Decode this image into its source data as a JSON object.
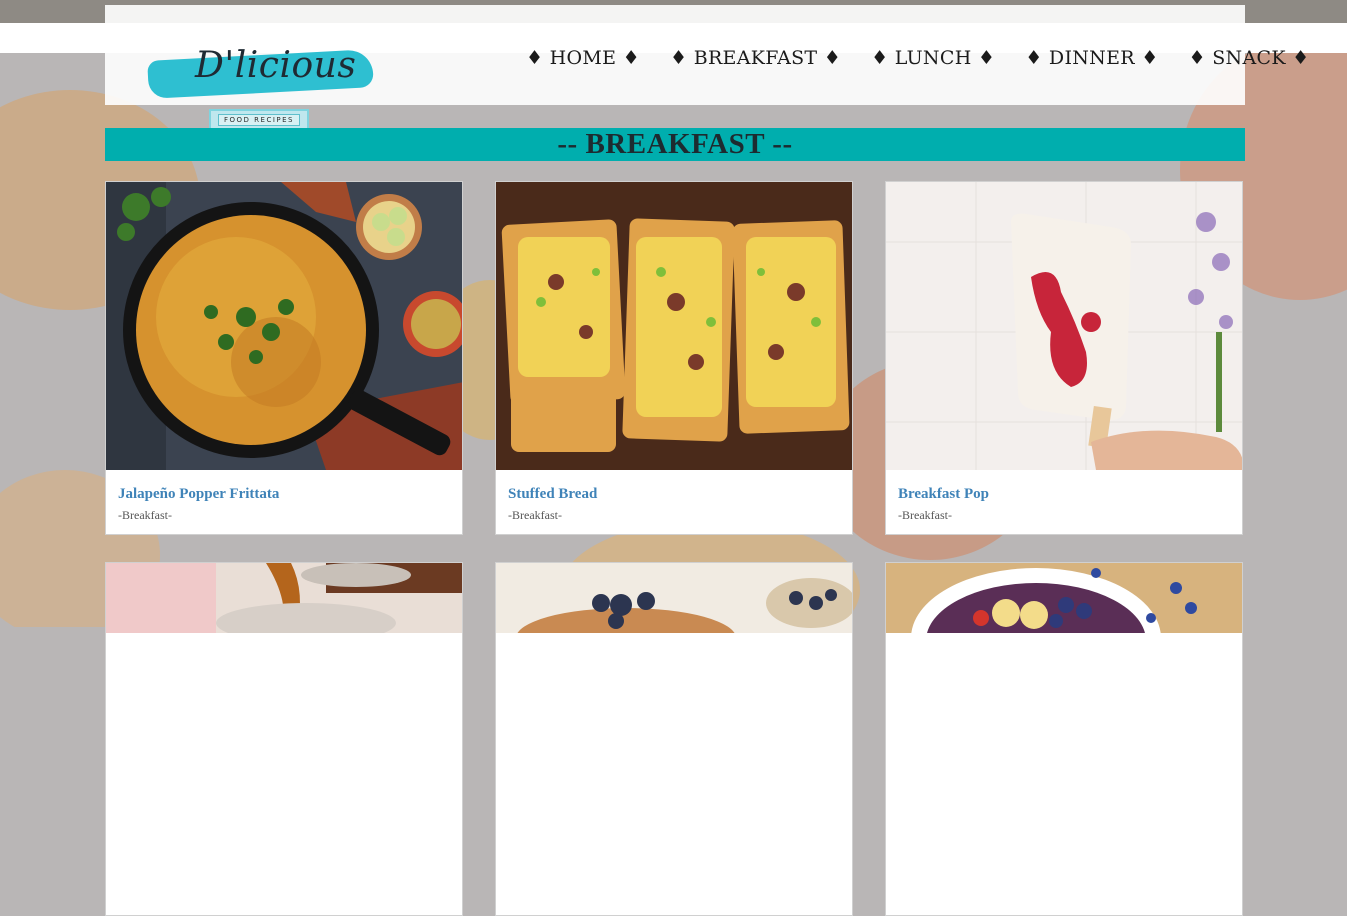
{
  "brand": {
    "logo_text": "D'licious",
    "tagline": "FOOD RECIPES"
  },
  "nav": {
    "items": [
      {
        "label": "♦ HOME ♦"
      },
      {
        "label": "♦ BREAKFAST ♦"
      },
      {
        "label": "♦ LUNCH ♦"
      },
      {
        "label": "♦ DINNER ♦"
      },
      {
        "label": "♦ SNACK ♦"
      }
    ]
  },
  "section": {
    "title": "-- BREAKFAST --"
  },
  "recipes": [
    {
      "title": "Jalapeño Popper Frittata",
      "category": "-Breakfast-"
    },
    {
      "title": "Stuffed Bread",
      "category": "-Breakfast-"
    },
    {
      "title": "Breakfast Pop",
      "category": "-Breakfast-"
    }
  ],
  "colors": {
    "accent": "#00aeae",
    "logo_stroke": "#2ebfd1",
    "link": "#3f83b8"
  }
}
